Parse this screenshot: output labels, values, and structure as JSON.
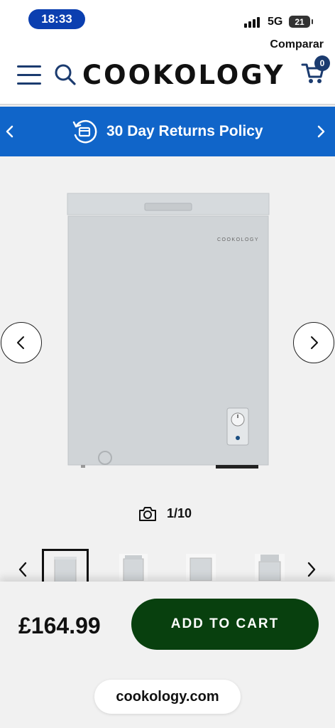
{
  "status_bar": {
    "time": "18:33",
    "network": "5G",
    "battery": "21"
  },
  "header": {
    "compare_label": "Comparar",
    "logo_text": "COOKOLOGY",
    "cart_count": "0",
    "icons": [
      "hamburger-menu-icon",
      "search-icon",
      "cart-icon"
    ]
  },
  "promo": {
    "text": "30 Day Returns Policy",
    "icon": "returns-icon"
  },
  "product": {
    "brand_text": "COOKOLOGY",
    "image_counter": "1/10",
    "price": "£164.99",
    "add_to_cart_label": "ADD TO CART"
  },
  "browser": {
    "url": "cookology.com"
  },
  "colors": {
    "brand_navy": "#1b3b6f",
    "promo_blue": "#1065c9",
    "cart_green": "#08400e",
    "time_pill": "#0b3fb0"
  }
}
